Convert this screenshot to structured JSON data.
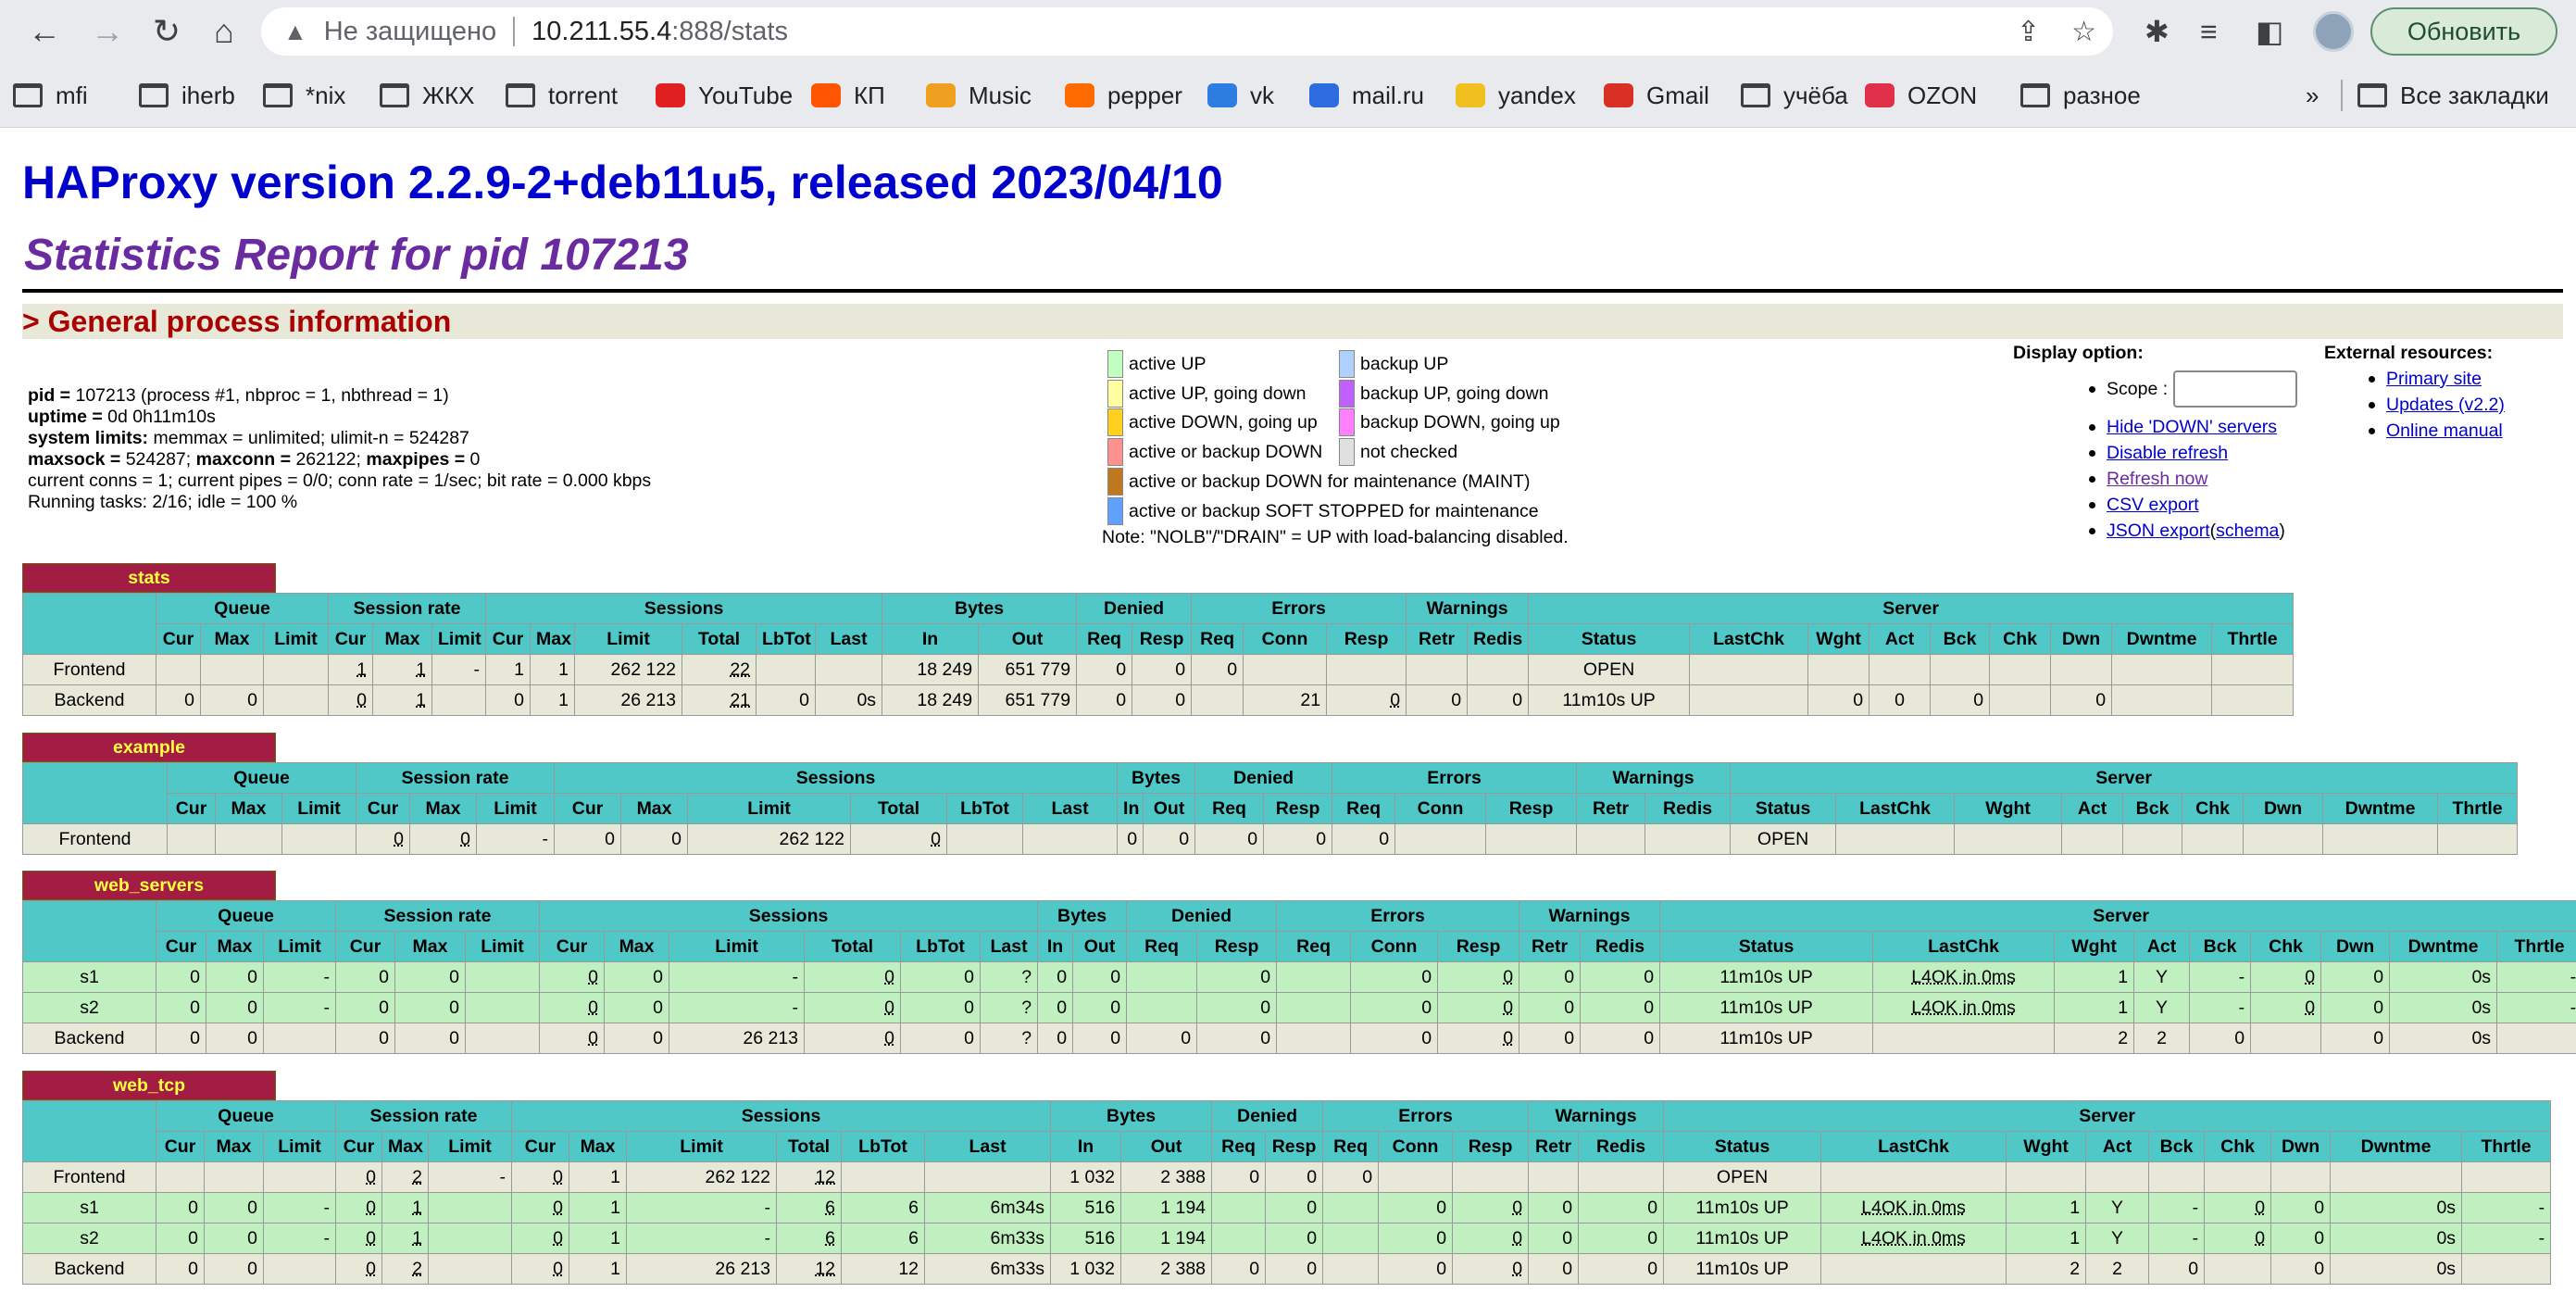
{
  "browser": {
    "nav": {
      "back": "←",
      "forward": "→",
      "reload": "↻",
      "home": "⌂"
    },
    "url": {
      "insecure": "Не защищено",
      "host": "10.211.55.4",
      "path": ":888/stats"
    },
    "update_button": "Обновить",
    "bookmarks": [
      {
        "label": "mfi",
        "icon": "folder-icon"
      },
      {
        "label": "iherb",
        "icon": "folder-icon"
      },
      {
        "label": "*nix",
        "icon": "folder-icon"
      },
      {
        "label": "ЖКХ",
        "icon": "folder-icon"
      },
      {
        "label": "torrent",
        "icon": "folder-icon"
      },
      {
        "label": "YouTube",
        "icon": "youtube-icon"
      },
      {
        "label": "КП",
        "icon": "kp-icon"
      },
      {
        "label": "Music",
        "icon": "music-icon"
      },
      {
        "label": "pepper",
        "icon": "pepper-icon"
      },
      {
        "label": "vk",
        "icon": "vk-icon"
      },
      {
        "label": "mail.ru",
        "icon": "mailru-icon"
      },
      {
        "label": "yandex",
        "icon": "yandex-mail-icon"
      },
      {
        "label": "Gmail",
        "icon": "gmail-icon"
      },
      {
        "label": "учёба",
        "icon": "folder-icon"
      },
      {
        "label": "OZON",
        "icon": "ozon-icon"
      },
      {
        "label": "разное",
        "icon": "folder-icon"
      }
    ],
    "more_bookmarks": "»",
    "all_bookmarks": "Все закладки"
  },
  "page": {
    "title": "HAProxy version 2.2.9-2+deb11u5, released 2023/04/10",
    "subtitle": "Statistics Report for pid 107213",
    "section": "> General process information"
  },
  "info": {
    "line1_a": "pid = ",
    "line1_b": "107213 (process #1, nbproc = 1, nbthread = 1)",
    "line2_a": "uptime = ",
    "line2_b": "0d 0h11m10s",
    "line3_a": "system limits:",
    "line3_b": " memmax = unlimited; ulimit-n = 524287",
    "line4_a": "maxsock = ",
    "line4_b": "524287; ",
    "line4_c": "maxconn = ",
    "line4_d": "262122; ",
    "line4_e": "maxpipes = ",
    "line4_f": "0",
    "line5": "current conns = 1; current pipes = 0/0; conn rate = 1/sec; bit rate = 0.000 kbps",
    "line6": "Running tasks: 2/16; idle = 100 %"
  },
  "legend": {
    "items": [
      {
        "label": "active UP",
        "color": "#c0ffc0"
      },
      {
        "label": "backup UP",
        "color": "#b0d0ff"
      },
      {
        "label": "active UP, going down",
        "color": "#ffffa0"
      },
      {
        "label": "backup UP, going down",
        "color": "#c060ff"
      },
      {
        "label": "active DOWN, going up",
        "color": "#ffd020"
      },
      {
        "label": "backup DOWN, going up",
        "color": "#ff80ff"
      },
      {
        "label": "active or backup DOWN",
        "color": "#ff9090"
      },
      {
        "label": "not checked",
        "color": "#e0e0e0"
      },
      {
        "label": "active or backup DOWN for maintenance (MAINT)",
        "color": "#c07820"
      },
      {
        "label": "active or backup SOFT STOPPED for maintenance",
        "color": "#60a0ff"
      }
    ],
    "note": "Note: \"NOLB\"/\"DRAIN\" = UP with load-balancing disabled."
  },
  "display_options": {
    "heading": "Display option:",
    "scope": "Scope :",
    "links": [
      "Hide 'DOWN' servers",
      "Disable refresh",
      "Refresh now",
      "CSV export",
      "JSON export"
    ],
    "schema_open": " (",
    "schema": "schema",
    "schema_close": ")"
  },
  "external": {
    "heading": "External resources:",
    "links": [
      "Primary site",
      "Updates (v2.2)",
      "Online manual"
    ]
  },
  "proxies": {
    "stats": {
      "name": "stats"
    },
    "example": {
      "name": "example"
    },
    "web_servers": {
      "name": "web_servers"
    },
    "web_tcp": {
      "name": "web_tcp"
    }
  },
  "headers": {
    "groups": [
      "Queue",
      "Session rate",
      "Sessions",
      "Bytes",
      "Denied",
      "Errors",
      "Warnings",
      "Server"
    ],
    "cols": [
      "Cur",
      "Max",
      "Limit",
      "Cur",
      "Max",
      "Limit",
      "Cur",
      "Max",
      "Limit",
      "Total",
      "LbTot",
      "Last",
      "In",
      "Out",
      "Req",
      "Resp",
      "Req",
      "Conn",
      "Resp",
      "Retr",
      "Redis",
      "Status",
      "LastChk",
      "Wght",
      "Act",
      "Bck",
      "Chk",
      "Dwn",
      "Dwntme",
      "Thrtle"
    ]
  },
  "rows": {
    "stats": [
      [
        "Frontend",
        "",
        "",
        "",
        "1",
        "1",
        "-",
        "1",
        "1",
        "262 122",
        "22",
        "",
        "",
        "18 249",
        "651 779",
        "0",
        "0",
        "0",
        "",
        "",
        "",
        "",
        "OPEN",
        "",
        "",
        "",
        "",
        "",
        "",
        "",
        ""
      ],
      [
        "Backend",
        "0",
        "0",
        "",
        "0",
        "1",
        "",
        "0",
        "1",
        "26 213",
        "21",
        "0",
        "0s",
        "18 249",
        "651 779",
        "0",
        "0",
        "",
        "21",
        "0",
        "0",
        "0",
        "11m10s UP",
        "",
        "0",
        "0",
        "0",
        "",
        "0",
        "",
        ""
      ]
    ],
    "example": [
      [
        "Frontend",
        "",
        "",
        "",
        "0",
        "0",
        "-",
        "0",
        "0",
        "262 122",
        "0",
        "",
        "",
        "0",
        "0",
        "0",
        "0",
        "0",
        "",
        "",
        "",
        "",
        "OPEN",
        "",
        "",
        "",
        "",
        "",
        "",
        "",
        ""
      ]
    ],
    "web_servers": [
      [
        "s1",
        "0",
        "0",
        "-",
        "0",
        "0",
        "",
        "0",
        "0",
        "-",
        "0",
        "0",
        "?",
        "0",
        "0",
        "",
        "0",
        "",
        "0",
        "0",
        "0",
        "0",
        "11m10s UP",
        "L4OK in 0ms",
        "1",
        "Y",
        "-",
        "0",
        "0",
        "0s",
        "-"
      ],
      [
        "s2",
        "0",
        "0",
        "-",
        "0",
        "0",
        "",
        "0",
        "0",
        "-",
        "0",
        "0",
        "?",
        "0",
        "0",
        "",
        "0",
        "",
        "0",
        "0",
        "0",
        "0",
        "11m10s UP",
        "L4OK in 0ms",
        "1",
        "Y",
        "-",
        "0",
        "0",
        "0s",
        "-"
      ],
      [
        "Backend",
        "0",
        "0",
        "",
        "0",
        "0",
        "",
        "0",
        "0",
        "26 213",
        "0",
        "0",
        "?",
        "0",
        "0",
        "0",
        "0",
        "",
        "0",
        "0",
        "0",
        "0",
        "11m10s UP",
        "",
        "2",
        "2",
        "0",
        "",
        "0",
        "0s",
        ""
      ]
    ],
    "web_tcp": [
      [
        "Frontend",
        "",
        "",
        "",
        "0",
        "2",
        "-",
        "0",
        "1",
        "262 122",
        "12",
        "",
        "",
        "1 032",
        "2 388",
        "0",
        "0",
        "0",
        "",
        "",
        "",
        "",
        "OPEN",
        "",
        "",
        "",
        "",
        "",
        "",
        "",
        ""
      ],
      [
        "s1",
        "0",
        "0",
        "-",
        "0",
        "1",
        "",
        "0",
        "1",
        "-",
        "6",
        "6",
        "6m34s",
        "516",
        "1 194",
        "",
        "0",
        "",
        "0",
        "0",
        "0",
        "0",
        "11m10s UP",
        "L4OK in 0ms",
        "1",
        "Y",
        "-",
        "0",
        "0",
        "0s",
        "-"
      ],
      [
        "s2",
        "0",
        "0",
        "-",
        "0",
        "1",
        "",
        "0",
        "1",
        "-",
        "6",
        "6",
        "6m33s",
        "516",
        "1 194",
        "",
        "0",
        "",
        "0",
        "0",
        "0",
        "0",
        "11m10s UP",
        "L4OK in 0ms",
        "1",
        "Y",
        "-",
        "0",
        "0",
        "0s",
        "-"
      ],
      [
        "Backend",
        "0",
        "0",
        "",
        "0",
        "2",
        "",
        "0",
        "1",
        "26 213",
        "12",
        "12",
        "6m33s",
        "1 032",
        "2 388",
        "0",
        "0",
        "",
        "0",
        "0",
        "0",
        "0",
        "11m10s UP",
        "",
        "2",
        "2",
        "0",
        "",
        "0",
        "0s",
        ""
      ]
    ]
  }
}
